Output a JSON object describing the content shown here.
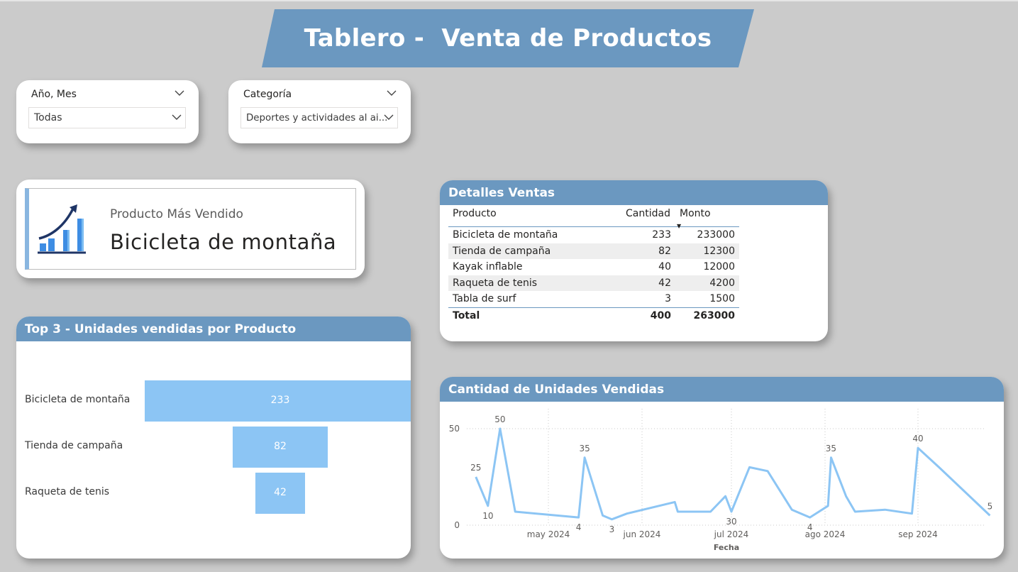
{
  "page_title": "Tablero -  Venta de Productos",
  "colors": {
    "banner": "#6b98c0",
    "header": "#6b98c0",
    "bar": "#8cc5f4",
    "line": "#8cc5f4",
    "kpi_accent": "#89b6e0"
  },
  "slicers": {
    "year_month": {
      "label": "Año, Mes",
      "selected": "Todas",
      "icon": "chevron-down-icon"
    },
    "category": {
      "label": "Categoría",
      "selected": "Deportes y actividades al ai...",
      "icon": "chevron-down-icon"
    }
  },
  "kpi": {
    "caption": "Producto Más Vendido",
    "value": "Bicicleta de montaña",
    "icon": "growth-chart-icon"
  },
  "details_table": {
    "title": "Detalles Ventas",
    "columns": [
      "Producto",
      "Cantidad",
      "Monto"
    ],
    "sorted_column": "Monto",
    "rows": [
      [
        "Bicicleta de montaña",
        "233",
        "233000"
      ],
      [
        "Tienda de campaña",
        "82",
        "12300"
      ],
      [
        "Kayak inflable",
        "40",
        "12000"
      ],
      [
        "Raqueta de tenis",
        "42",
        "4200"
      ],
      [
        "Tabla de surf",
        "3",
        "1500"
      ]
    ],
    "total": [
      "Total",
      "400",
      "263000"
    ]
  },
  "chart_data": [
    {
      "type": "bar",
      "subtype": "funnel",
      "title": "Top 3 - Unidades vendidas por Producto",
      "categories": [
        "Bicicleta de montaña",
        "Tienda de campaña",
        "Raqueta de tenis"
      ],
      "values": [
        233,
        82,
        42
      ]
    },
    {
      "type": "line",
      "title": "Cantidad de Unidades Vendidas",
      "xlabel": "Fecha",
      "ylabel": "",
      "ylim": [
        0,
        55
      ],
      "yticks": [
        0,
        50
      ],
      "xticks": [
        "may 2024",
        "jun 2024",
        "jul 2024",
        "ago 2024",
        "sep 2024"
      ],
      "xtick_dates": [
        "2024-05-01",
        "2024-06-01",
        "2024-07-01",
        "2024-08-01",
        "2024-09-01"
      ],
      "grid": true,
      "series": [
        {
          "x": [
            "2024-04-07",
            "2024-04-11",
            "2024-04-15",
            "2024-04-20",
            "2024-05-11",
            "2024-05-13",
            "2024-05-19",
            "2024-05-22",
            "2024-05-27",
            "2024-06-12",
            "2024-06-13",
            "2024-06-24",
            "2024-06-29",
            "2024-07-01",
            "2024-07-07",
            "2024-07-13",
            "2024-07-21",
            "2024-07-27",
            "2024-08-02",
            "2024-08-03",
            "2024-08-08",
            "2024-08-11",
            "2024-08-21",
            "2024-08-30",
            "2024-09-01",
            "2024-09-08",
            "2024-09-25"
          ],
          "y": [
            25,
            10,
            50,
            7,
            4,
            35,
            5,
            3,
            6,
            12,
            7,
            7,
            15,
            7,
            30,
            28,
            8,
            4,
            10,
            35,
            15,
            7,
            8,
            6,
            40,
            30,
            5
          ]
        }
      ],
      "data_labels": [
        {
          "x": "2024-04-07",
          "text": "25"
        },
        {
          "x": "2024-04-11",
          "text": "10"
        },
        {
          "x": "2024-04-15",
          "text": "50"
        },
        {
          "x": "2024-05-11",
          "text": "4"
        },
        {
          "x": "2024-05-13",
          "text": "35"
        },
        {
          "x": "2024-05-22",
          "text": "3"
        },
        {
          "x": "2024-07-01",
          "text": "30"
        },
        {
          "x": "2024-07-27",
          "text": "4"
        },
        {
          "x": "2024-08-03",
          "text": "35"
        },
        {
          "x": "2024-09-01",
          "text": "40"
        },
        {
          "x": "2024-09-25",
          "text": "5"
        }
      ]
    }
  ]
}
